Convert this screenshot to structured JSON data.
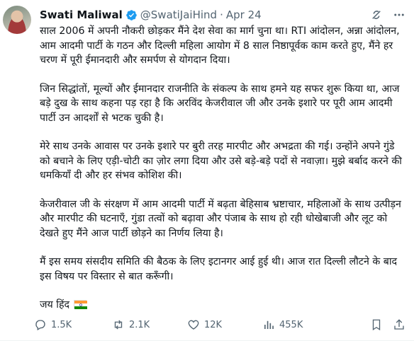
{
  "author": {
    "name": "Swati Maliwal",
    "handle": "@SwatiJaiHind",
    "date": "Apr 24",
    "separator": "·"
  },
  "tweet": {
    "paragraphs": [
      "साल 2006 में अपनी नौकरी छोड़कर मैंने देश सेवा का मार्ग चुना था। RTI आंदोलन, अन्ना आंदोलन, आम आदमी पार्टी के गठन और दिल्ली महिला आयोग में 8 साल निष्ठापूर्वक काम करते हुए, मैंने हर चरण में पूरी ईमानदारी और समर्पण से योगदान दिया।",
      "जिन सिद्धांतों, मूल्यों और ईमानदार राजनीति के संकल्प के साथ हमने यह सफर शुरू किया था, आज बड़े दुख के साथ कहना पड़ रहा है कि अरविंद केजरीवाल जी और उनके इशारे पर पूरी आम आदमी पार्टी उन आदर्शों से भटक चुकी है।",
      "मेरे साथ उनके आवास पर उनके इशारे पर बुरी तरह मारपीट और अभद्रता की गई। उन्होंने अपने गुंडे को बचाने के लिए एड़ी-चोटी का ज़ोर लगा दिया और उसे बड़े-बड़े पदों से नवाज़ा। मुझे बर्बाद करने की धमकियाँ दी और हर संभव कोशिश की।",
      "केजरीवाल जी के संरक्षण में आम आदमी पार्टी में बढ़ता बेहिसाब भ्रष्टाचार, महिलाओं के साथ उत्पीड़न और मारपीट की घटनाएँ, गुंडा तत्वों को बढ़ावा और पंजाब के साथ हो रही धोखेबाजी और लूट को देखते हुए मैंने आज पार्टी छोड़ने का निर्णय लिया है।",
      "मैं इस समय संसदीय समिति की बैठक के लिए इटानगर आई हुई थी। आज रात दिल्ली लौटने के बाद इस विषय पर विस्तार से बात करूँगी।"
    ],
    "closing": "जय हिंद"
  },
  "actions": {
    "replies": "1.5K",
    "reposts": "2.1K",
    "likes": "12K",
    "views": "455K"
  },
  "icons": {
    "verified": "verified-badge-icon",
    "grok": "grok-icon",
    "more": "more-icon",
    "reply": "reply-icon",
    "repost": "repost-icon",
    "like": "heart-icon",
    "views": "views-icon",
    "bookmark": "bookmark-icon",
    "share": "share-icon",
    "flag": "india-flag-icon"
  },
  "colors": {
    "text": "#0f1419",
    "secondary": "#536471",
    "verified": "#1d9bf0",
    "saffron": "#ff9933",
    "green": "#138808",
    "chakra": "#000080"
  }
}
